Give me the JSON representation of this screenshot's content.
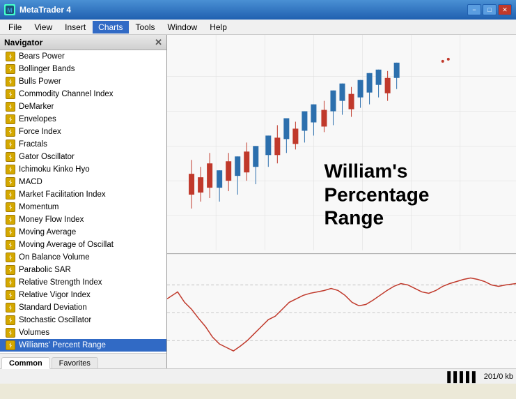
{
  "titleBar": {
    "title": "MetaTrader 4",
    "iconLabel": "MT",
    "minBtn": "−",
    "maxBtn": "□",
    "closeBtn": "✕"
  },
  "menuBar": {
    "items": [
      "File",
      "View",
      "Insert",
      "Charts",
      "Tools",
      "Window",
      "Help"
    ],
    "activeItem": "Charts"
  },
  "innerTitleBar": {
    "title": "Navigator",
    "minBtn": "−",
    "maxBtn": "□",
    "closeBtn": "✕"
  },
  "navigator": {
    "header": "Navigator",
    "items": [
      "Bears Power",
      "Bollinger Bands",
      "Bulls Power",
      "Commodity Channel Index",
      "DeMarker",
      "Envelopes",
      "Force Index",
      "Fractals",
      "Gator Oscillator",
      "Ichimoku Kinko Hyo",
      "MACD",
      "Market Facilitation Index",
      "Momentum",
      "Money Flow Index",
      "Moving Average",
      "Moving Average of Oscillat",
      "On Balance Volume",
      "Parabolic SAR",
      "Relative Strength Index",
      "Relative Vigor Index",
      "Standard Deviation",
      "Stochastic Oscillator",
      "Volumes",
      "Williams' Percent Range"
    ],
    "tabs": [
      "Common",
      "Favorites"
    ],
    "activeTab": "Common"
  },
  "chart": {
    "label1": "William's Percentage",
    "label2": "Range"
  },
  "statusBar": {
    "barsIcon": "▌▌▌▌▌",
    "info": "201/0 kb"
  }
}
